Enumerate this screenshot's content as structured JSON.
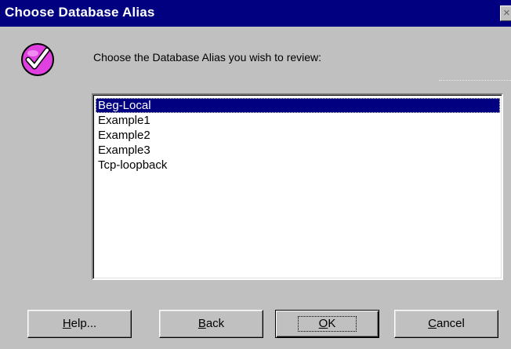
{
  "window": {
    "title": "Choose Database Alias",
    "close_glyph": "×"
  },
  "prompt": "Choose the Database Alias you wish to review:",
  "icon": {
    "name": "checkmark-icon",
    "color": "#e040e0"
  },
  "aliases": {
    "items": [
      {
        "label": "Beg-Local",
        "selected": true
      },
      {
        "label": "Example1",
        "selected": false
      },
      {
        "label": "Example2",
        "selected": false
      },
      {
        "label": "Example3",
        "selected": false
      },
      {
        "label": "Tcp-loopback",
        "selected": false
      }
    ]
  },
  "buttons": {
    "help": {
      "mnemonic": "H",
      "rest": "elp..."
    },
    "back": {
      "mnemonic": "B",
      "rest": "ack"
    },
    "ok": {
      "mnemonic": "O",
      "rest": "K"
    },
    "cancel": {
      "mnemonic": "C",
      "rest": "ancel"
    }
  },
  "colors": {
    "titlebar": "#000080",
    "dialog_face": "#c0c0c0",
    "selection": "#000080"
  }
}
